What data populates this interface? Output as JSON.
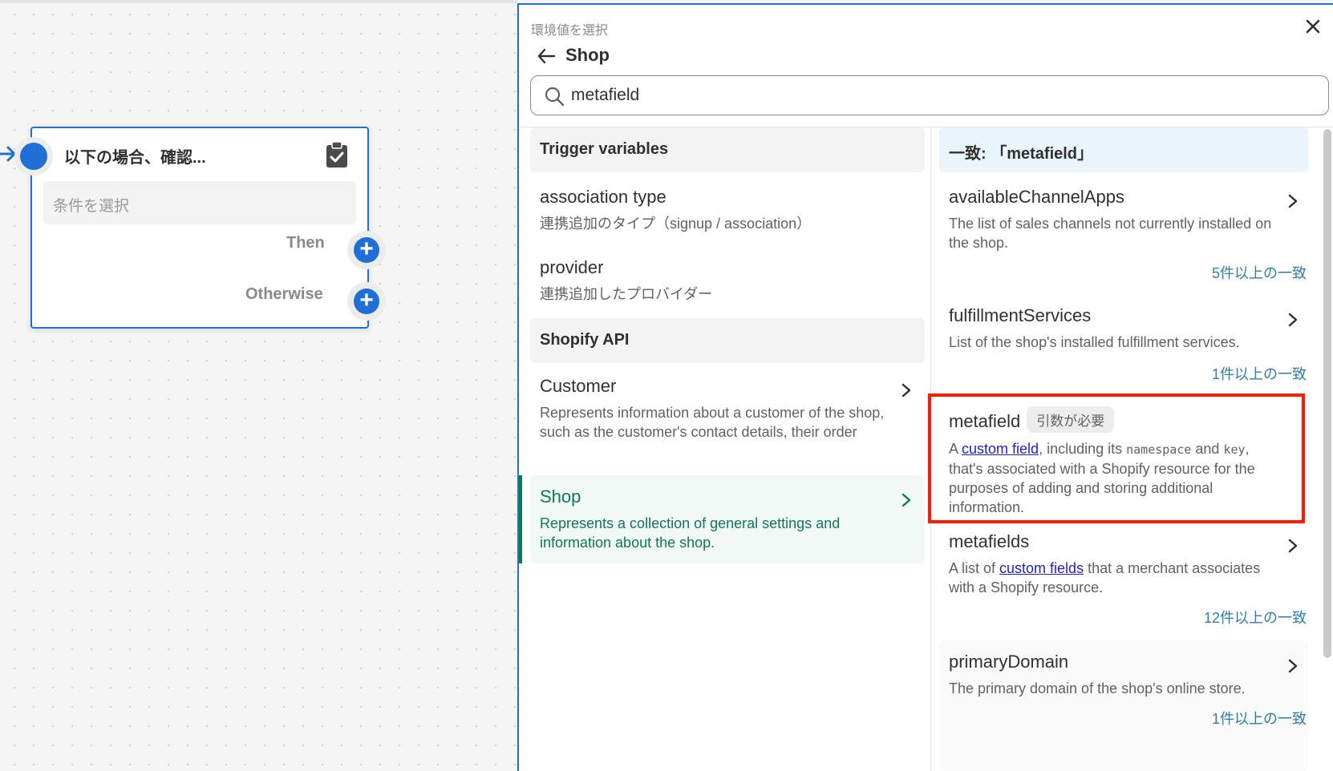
{
  "canvas": {
    "node": {
      "title": "以下の場合、確認...",
      "condition_placeholder": "条件を選択",
      "then_label": "Then",
      "otherwise_label": "Otherwise"
    }
  },
  "panel": {
    "subtitle": "環境値を選択",
    "title": "Shop",
    "search": {
      "value": "metafield"
    },
    "left": {
      "sections": [
        {
          "heading": "Trigger variables"
        },
        {
          "heading": "Shopify API"
        }
      ],
      "trigger_items": [
        {
          "name": "association type",
          "desc": "連携追加のタイプ（signup / association）"
        },
        {
          "name": "provider",
          "desc": "連携追加したプロバイダー"
        }
      ],
      "api_items": [
        {
          "name": "Customer",
          "desc": "Represents information about a customer of the shop, such as the customer's contact details, their order"
        },
        {
          "name": "Shop",
          "desc": "Represents a collection of general settings and information about the shop.",
          "selected": true
        }
      ]
    },
    "right": {
      "heading": "一致: 「metafield」",
      "items": [
        {
          "name": "availableChannelApps",
          "desc": "The list of sales channels not currently installed on the shop.",
          "matches": "5件以上の一致"
        },
        {
          "name": "fulfillmentServices",
          "desc": "List of the shop's installed fulfillment services.",
          "matches": "1件以上の一致"
        },
        {
          "name": "metafield",
          "badge": "引数が必要",
          "desc_parts": {
            "p1": "A ",
            "link": "custom field",
            "p2": ", including its ",
            "code1": "namespace",
            "p3": " and ",
            "code2": "key",
            "p4": ", that's associated with a Shopify resource for the purposes of adding and storing additional information."
          }
        },
        {
          "name": "metafields",
          "desc_parts": {
            "p1": "A list of ",
            "link": "custom fields",
            "p2": " that a merchant associates with a Shopify resource."
          },
          "matches": "12件以上の一致"
        },
        {
          "name": "primaryDomain",
          "desc": "The primary domain of the shop's online store.",
          "matches": "1件以上の一致"
        }
      ]
    }
  },
  "colors": {
    "accent": "#1f6fd6",
    "selected": "#0d7a50",
    "highlight": "#ff1a00",
    "link": "#2020d0",
    "match": "#2e7eaa"
  }
}
